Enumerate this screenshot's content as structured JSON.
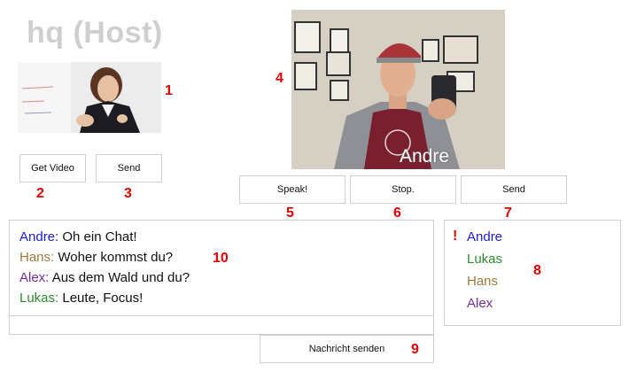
{
  "host": {
    "title": "hq (Host)"
  },
  "buttons": {
    "get_video": "Get Video",
    "send_small": "Send",
    "speak": "Speak!",
    "stop": "Stop.",
    "send": "Send",
    "send_message": "Nachricht senden"
  },
  "remote_video": {
    "overlay_name": "Andre"
  },
  "chat": {
    "messages": [
      {
        "user": "Andre:",
        "text": "Oh ein Chat!",
        "color": "#1a1ad6"
      },
      {
        "user": "Hans:",
        "text": "Woher kommst du?",
        "color": "#a07a3a"
      },
      {
        "user": "Alex:",
        "text": "Aus dem Wald und du?",
        "color": "#7a2a9a"
      },
      {
        "user": "Lukas:",
        "text": "Leute, Focus!",
        "color": "#2e8a2e"
      }
    ],
    "input_value": ""
  },
  "users": {
    "alert_mark": "!",
    "list": [
      {
        "name": "Andre",
        "color": "#1a1ad6"
      },
      {
        "name": "Lukas",
        "color": "#2e8a2e"
      },
      {
        "name": "Hans",
        "color": "#a07a3a"
      },
      {
        "name": "Alex",
        "color": "#7a2a9a"
      }
    ]
  },
  "annotations": [
    "1",
    "2",
    "3",
    "4",
    "5",
    "6",
    "7",
    "8",
    "9",
    "10"
  ],
  "colors": {
    "annotation": "#e00000",
    "title": "#cfcfcf",
    "border": "#cfcfcf"
  }
}
